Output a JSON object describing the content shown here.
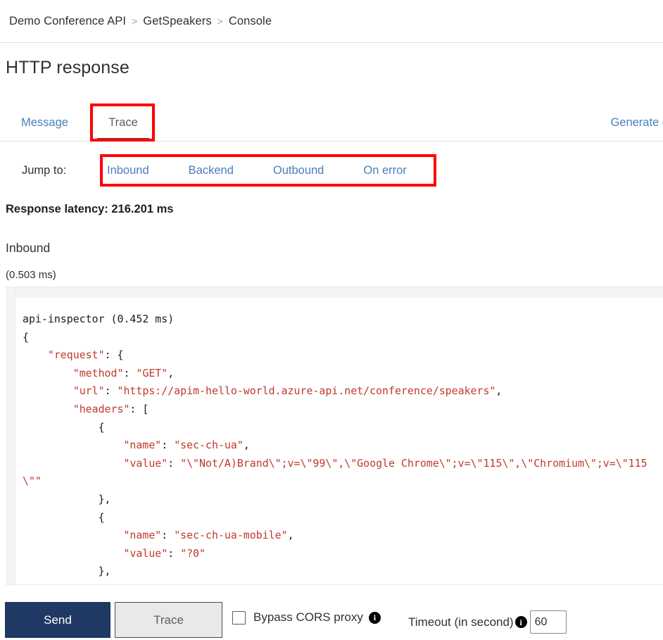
{
  "breadcrumb": {
    "items": [
      "Demo Conference API",
      "GetSpeakers",
      "Console"
    ],
    "separator": ">"
  },
  "page": {
    "title": "HTTP response"
  },
  "tabs": {
    "message_label": "Message",
    "trace_label": "Trace",
    "selected": "Trace",
    "generate_link_label": "Generate d"
  },
  "jump_to": {
    "label": "Jump to:",
    "links": [
      "Inbound",
      "Backend",
      "Outbound",
      "On error"
    ]
  },
  "latency": {
    "text": "Response latency: 216.201 ms"
  },
  "inbound": {
    "heading": "Inbound",
    "time": "(0.503 ms)"
  },
  "code": {
    "title": "api-inspector (0.452 ms)",
    "lines": [
      "api-inspector (0.452 ms)",
      "{",
      "    \"request\": {",
      "        \"method\": \"GET\",",
      "        \"url\": \"https://apim-hello-world.azure-api.net/conference/speakers\",",
      "        \"headers\": [",
      "            {",
      "                \"name\": \"sec-ch-ua\",",
      "                \"value\": \"\\\"Not/A)Brand\\\";v=\\\"99\\\",\\\"Google Chrome\\\";v=\\\"115\\\",\\\"Chromium\\\";v=\\\"115\\\"\"",
      "            },",
      "            {",
      "                \"name\": \"sec-ch-ua-mobile\",",
      "                \"value\": \"?0\"",
      "            },",
      "            {"
    ]
  },
  "toolbar": {
    "send_label": "Send",
    "trace_label": "Trace",
    "bypass_cors_label": "Bypass CORS proxy",
    "bypass_cors_checked": false,
    "timeout_label": "Timeout (in second)",
    "timeout_value": "60",
    "info_glyph": "i"
  },
  "colors": {
    "accent_link": "#4a7ebb",
    "send_button": "#1f3864",
    "annotation_red": "#ff0000",
    "json_key": "#c0392b"
  }
}
